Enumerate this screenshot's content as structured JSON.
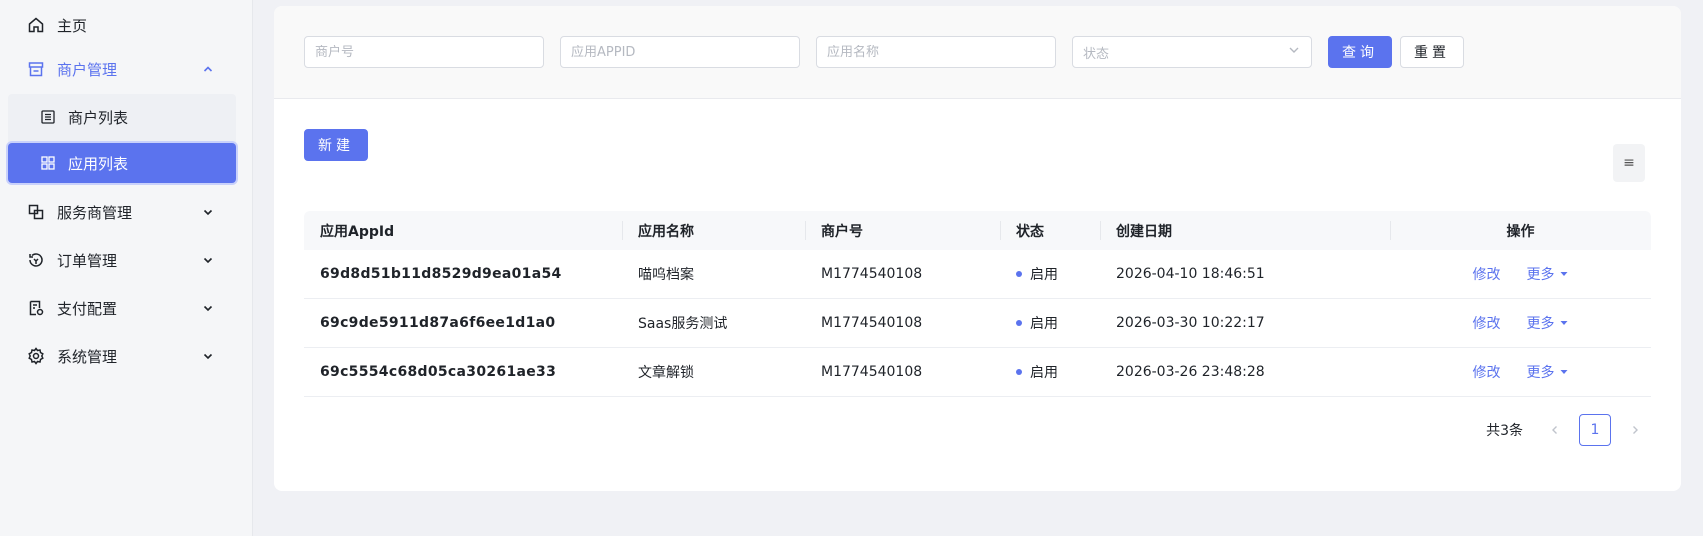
{
  "sidebar": {
    "home": "主页",
    "merchant_mgmt": "商户管理",
    "merchant_list": "商户列表",
    "app_list": "应用列表",
    "service_provider_mgmt": "服务商管理",
    "order_mgmt": "订单管理",
    "payment_config": "支付配置",
    "system_mgmt": "系统管理"
  },
  "filters": {
    "merchant_no_placeholder": "商户号",
    "app_id_placeholder": "应用APPID",
    "app_name_placeholder": "应用名称",
    "status_placeholder": "状态",
    "query_label": "查询",
    "reset_label": "重置"
  },
  "toolbar": {
    "new_label": "新建",
    "settings_icon": "≡"
  },
  "table": {
    "headers": [
      "应用AppId",
      "应用名称",
      "商户号",
      "状态",
      "创建日期",
      "操作"
    ],
    "rows": [
      {
        "app_id": "69d8d51b11d8529d9ea01a54",
        "app_name": "喵呜档案",
        "merchant_no": "M1774540108",
        "status": "启用",
        "created": "2026-04-10 18:46:51",
        "edit": "修改",
        "more": "更多"
      },
      {
        "app_id": "69c9de5911d87a6f6ee1d1a0",
        "app_name": "Saas服务测试",
        "merchant_no": "M1774540108",
        "status": "启用",
        "created": "2026-03-30 10:22:17",
        "edit": "修改",
        "more": "更多"
      },
      {
        "app_id": "69c5554c68d05ca30261ae33",
        "app_name": "文章解锁",
        "merchant_no": "M1774540108",
        "status": "启用",
        "created": "2026-03-26 23:48:28",
        "edit": "修改",
        "more": "更多"
      }
    ]
  },
  "pagination": {
    "total": "共3条",
    "current": "1"
  },
  "colors": {
    "primary": "#5b73ee",
    "sidebar_bg": "#f5f6f8",
    "page_bg": "#f0f1f5"
  }
}
